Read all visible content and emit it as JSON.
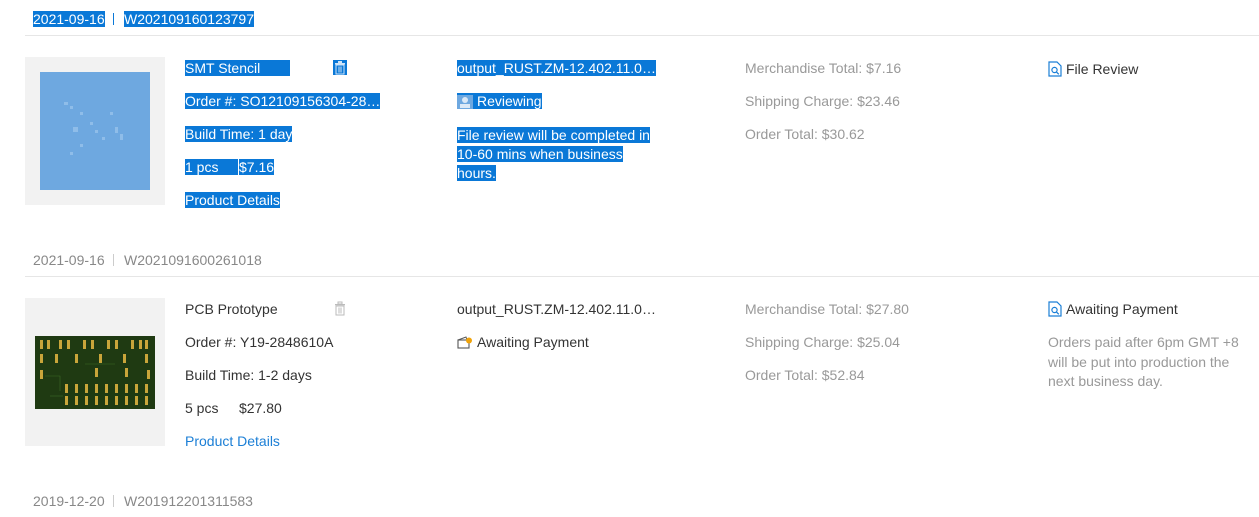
{
  "orders": [
    {
      "date": "2021-09-16",
      "order_no": "W202109160123797",
      "product": "SMT Stencil",
      "order_id": "Order #: SO12109156304-28…",
      "build_time": "Build Time: 1 day",
      "qty": "1 pcs",
      "price": "$7.16",
      "details_link": "Product Details",
      "file": "output_RUST.ZM-12.402.11.0…",
      "status": "Reviewing",
      "status_note": "File review will be completed in 10-60 mins when business hours.",
      "merchandise": "Merchandise Total: $7.16",
      "shipping": "Shipping Charge: $23.46",
      "total": "Order Total: $30.62",
      "action": "File Review",
      "action_note": ""
    },
    {
      "date": "2021-09-16",
      "order_no": "W2021091600261018",
      "product": "PCB Prototype",
      "order_id": "Order #: Y19-2848610A",
      "build_time": "Build Time: 1-2 days",
      "qty": "5 pcs",
      "price": "$27.80",
      "details_link": "Product Details",
      "file": "output_RUST.ZM-12.402.11.0…",
      "status": "Awaiting Payment",
      "status_note": "",
      "merchandise": "Merchandise Total: $27.80",
      "shipping": "Shipping Charge: $25.04",
      "total": "Order Total: $52.84",
      "action": "Awaiting Payment",
      "action_note": "Orders paid after 6pm GMT +8 will be put into production the next business day."
    },
    {
      "date": "2019-12-20",
      "order_no": "W201912201311583"
    }
  ],
  "colors": {
    "selection": "#0a78d7",
    "link": "#1c7fd6",
    "muted": "#999999",
    "pcb_green": "#1f3a12",
    "stencil_blue": "#6ea8e0"
  }
}
